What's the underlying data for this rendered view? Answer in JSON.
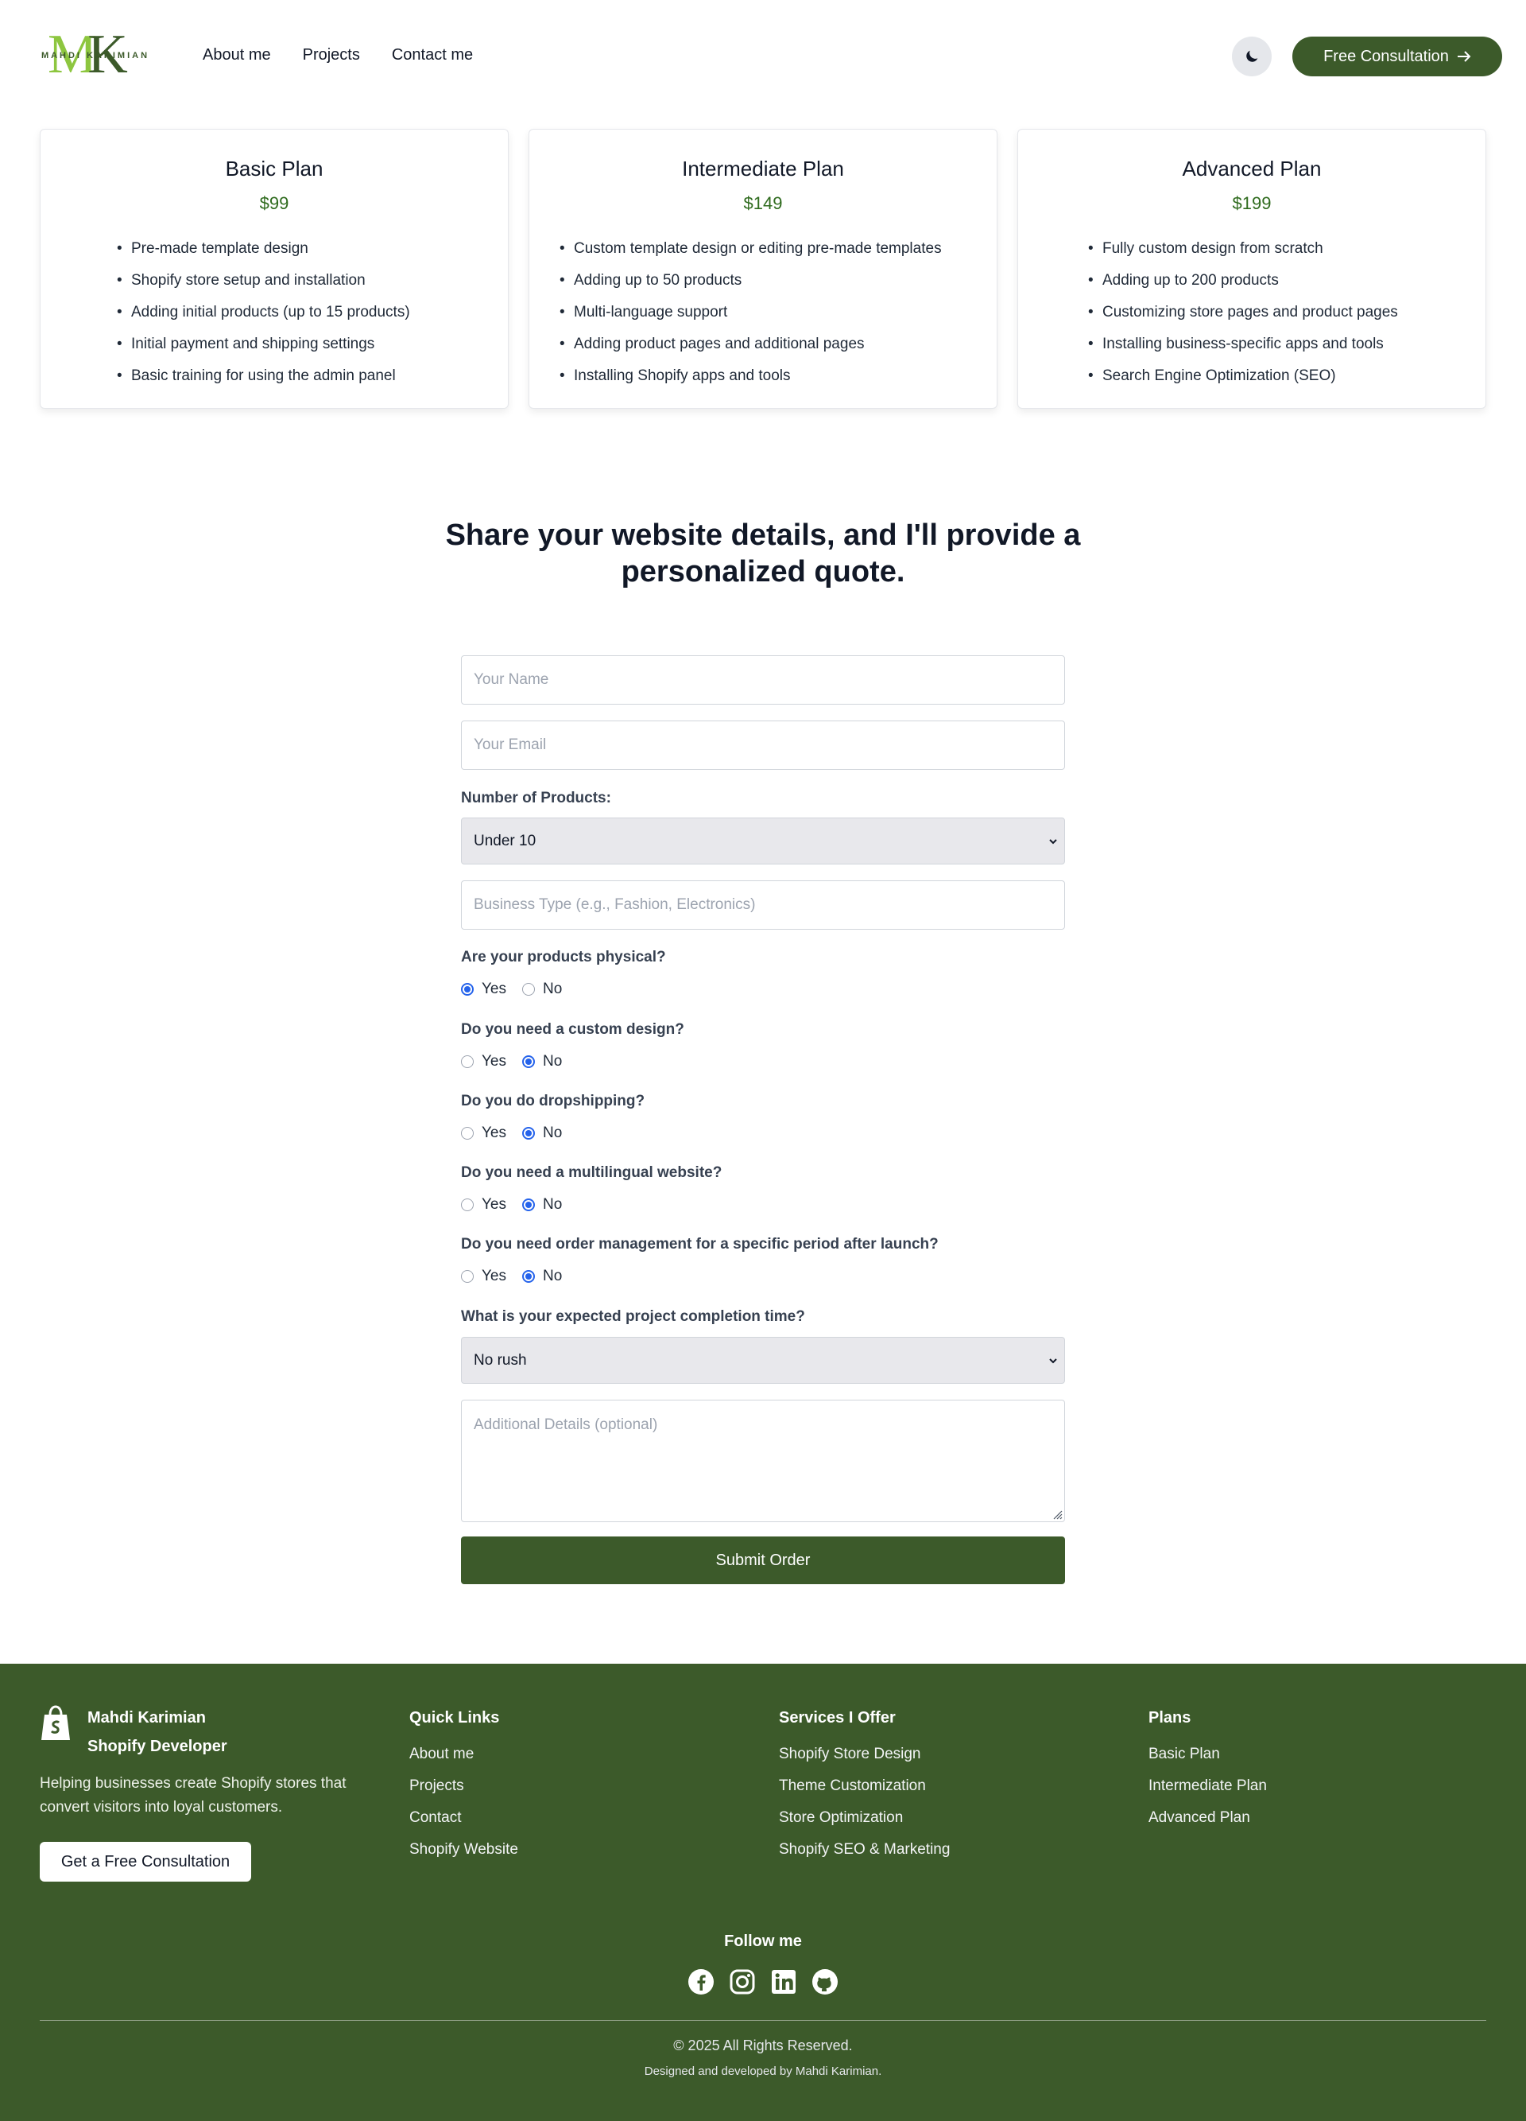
{
  "header": {
    "logo_letters_m": "M",
    "logo_letters_k": "K",
    "logo_name": "MAHDI KARIMIAN",
    "nav": [
      "About me",
      "Projects",
      "Contact me"
    ],
    "cta_label": "Free Consultation"
  },
  "plans": [
    {
      "title": "Basic Plan",
      "price": "$99",
      "features": [
        "Pre-made template design",
        "Shopify store setup and installation",
        "Adding initial products (up to 15 products)",
        "Initial payment and shipping settings",
        "Basic training for using the admin panel"
      ]
    },
    {
      "title": "Intermediate Plan",
      "price": "$149",
      "features": [
        "Custom template design or editing pre-made templates",
        "Adding up to 50 products",
        "Multi-language support",
        "Adding product pages and additional pages",
        "Installing Shopify apps and tools"
      ]
    },
    {
      "title": "Advanced Plan",
      "price": "$199",
      "features": [
        "Fully custom design from scratch",
        "Adding up to 200 products",
        "Customizing store pages and product pages",
        "Installing business-specific apps and tools",
        "Search Engine Optimization (SEO)"
      ]
    }
  ],
  "form": {
    "title": "Share your website details, and I'll provide a personalized quote.",
    "name_placeholder": "Your Name",
    "email_placeholder": "Your Email",
    "products_label": "Number of Products:",
    "products_value": "Under 10",
    "business_placeholder": "Business Type (e.g., Fashion, Electronics)",
    "questions": [
      {
        "label": "Are your products physical?",
        "selected": "Yes"
      },
      {
        "label": "Do you need a custom design?",
        "selected": "No"
      },
      {
        "label": "Do you do dropshipping?",
        "selected": "No"
      },
      {
        "label": "Do you need a multilingual website?",
        "selected": "No"
      },
      {
        "label": "Do you need order management for a specific period after launch?",
        "selected": "No"
      }
    ],
    "yes_label": "Yes",
    "no_label": "No",
    "completion_label": "What is your expected project completion time?",
    "completion_value": "No rush",
    "details_placeholder": "Additional Details (optional)",
    "submit_label": "Submit Order"
  },
  "footer": {
    "brand_name": "Mahdi Karimian",
    "brand_role": "Shopify Developer",
    "brand_desc": "Helping businesses create Shopify stores that convert visitors into loyal customers.",
    "cta_label": "Get a Free Consultation",
    "quick_links_title": "Quick Links",
    "quick_links": [
      "About me",
      "Projects",
      "Contact",
      "Shopify Website"
    ],
    "services_title": "Services I Offer",
    "services": [
      "Shopify Store Design",
      "Theme Customization",
      "Store Optimization",
      "Shopify SEO & Marketing"
    ],
    "plans_title": "Plans",
    "plans": [
      "Basic Plan",
      "Intermediate Plan",
      "Advanced Plan"
    ],
    "follow_label": "Follow me",
    "socials": [
      "facebook-icon",
      "instagram-icon",
      "linkedin-icon",
      "github-icon"
    ],
    "copyright": "© 2025 All Rights Reserved.",
    "credit": "Designed and developed by Mahdi Karimian."
  },
  "colors": {
    "brand_green": "#3c5a2a",
    "logo_light_green": "#8dc63f",
    "price_green": "#2f6b1e",
    "radio_blue": "#2563eb"
  }
}
